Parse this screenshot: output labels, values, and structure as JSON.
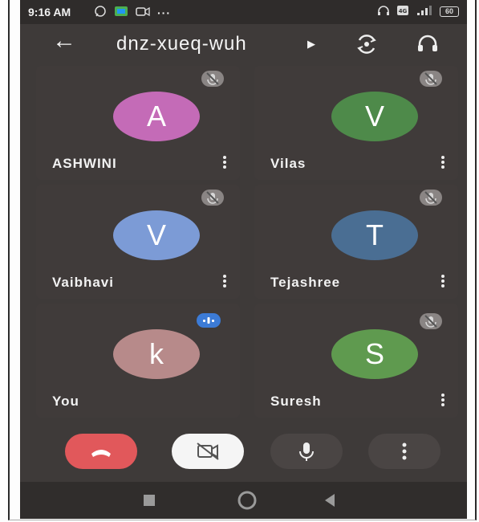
{
  "status": {
    "time": "9:16 AM",
    "battery": "60"
  },
  "header": {
    "meeting_code": "dnz-xueq-wuh"
  },
  "participants": [
    {
      "initial": "A",
      "name": "ASHWINI",
      "color": "#c46bb7",
      "muted": true
    },
    {
      "initial": "V",
      "name": "Vilas",
      "color": "#4e8a4a",
      "muted": true
    },
    {
      "initial": "V",
      "name": "Vaibhavi",
      "color": "#7c9bd6",
      "muted": true
    },
    {
      "initial": "T",
      "name": "Tejashree",
      "color": "#4a6e93",
      "muted": true
    },
    {
      "initial": "k",
      "name": "You",
      "color": "#b78a8a",
      "muted": false,
      "speaking": true
    },
    {
      "initial": "S",
      "name": "Suresh",
      "color": "#5f9a4f",
      "muted": true
    }
  ],
  "controls": {
    "end_call_color": "#e1585b",
    "camera_off_bg": "#f5f5f5",
    "mic_bg": "#4a4544",
    "more_bg": "#4a4544"
  }
}
